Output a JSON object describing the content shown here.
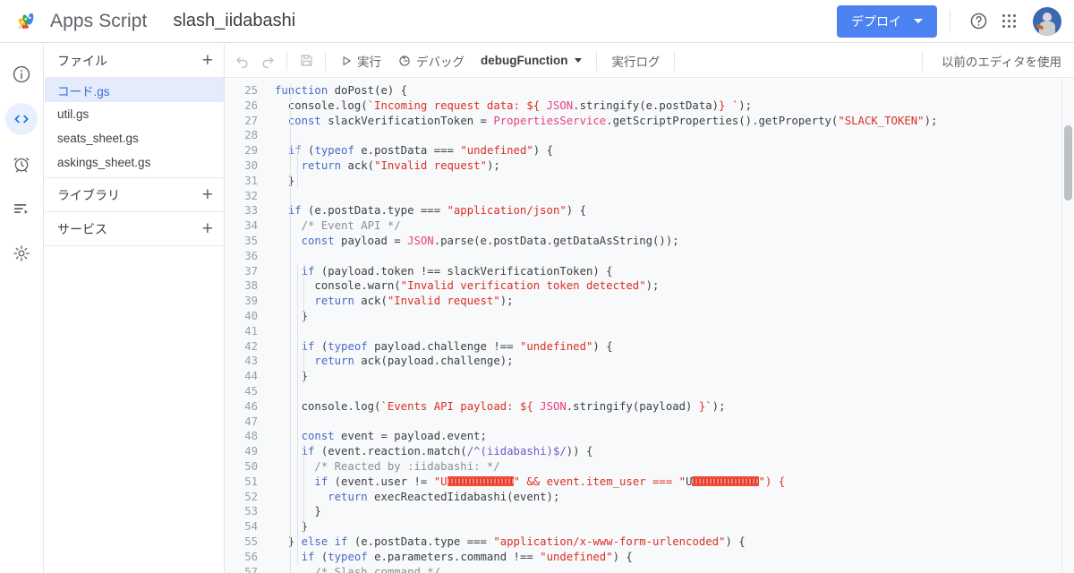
{
  "topbar": {
    "logo_icon": "apps-script-logo",
    "brand": "Apps Script",
    "project_title": "slash_iidabashi",
    "deploy_button": "デプロイ",
    "help_icon": "help-circle-icon",
    "apps_icon": "apps-grid-icon",
    "avatar_icon": "user-avatar"
  },
  "rail": {
    "items": [
      {
        "name": "overview",
        "icon": "info-circle-icon",
        "active": false
      },
      {
        "name": "editor",
        "icon": "code-brackets-icon",
        "active": true
      },
      {
        "name": "triggers",
        "icon": "alarm-clock-icon",
        "active": false
      },
      {
        "name": "executions",
        "icon": "executions-list-icon",
        "active": false
      },
      {
        "name": "settings",
        "icon": "gear-icon",
        "active": false
      }
    ]
  },
  "sidebar": {
    "files_header": "ファイル",
    "files_add_icon": "plus-icon",
    "files": [
      {
        "label": "コード.gs",
        "selected": true
      },
      {
        "label": "util.gs",
        "selected": false
      },
      {
        "label": "seats_sheet.gs",
        "selected": false
      },
      {
        "label": "askings_sheet.gs",
        "selected": false
      }
    ],
    "libraries_header": "ライブラリ",
    "libraries_add_icon": "plus-icon",
    "services_header": "サービス",
    "services_add_icon": "plus-icon"
  },
  "toolbar": {
    "undo_icon": "undo-arrow-icon",
    "redo_icon": "redo-arrow-icon",
    "save_icon": "save-disk-icon",
    "run_icon": "play-triangle-icon",
    "run_label": "実行",
    "debug_icon": "debug-bug-icon",
    "debug_label": "デバッグ",
    "function_selector": "debugFunction",
    "function_caret_icon": "caret-down-icon",
    "execution_log_label": "実行ログ",
    "legacy_editor_label": "以前のエディタを使用"
  },
  "editor": {
    "first_line_number": 25,
    "last_line_number": 57,
    "scrollbar_icon": "vertical-scrollbar-thumb",
    "lines": [
      {
        "n": 25,
        "t": "function doPost(e) {"
      },
      {
        "n": 26,
        "t": "  console.log(`Incoming request data: ${ JSON.stringify(e.postData)} `);"
      },
      {
        "n": 27,
        "t": "  const slackVerificationToken = PropertiesService.getScriptProperties().getProperty(\"SLACK_TOKEN\");"
      },
      {
        "n": 28,
        "t": ""
      },
      {
        "n": 29,
        "t": "  if (typeof e.postData === \"undefined\") {"
      },
      {
        "n": 30,
        "t": "    return ack(\"Invalid request\");"
      },
      {
        "n": 31,
        "t": "  }"
      },
      {
        "n": 32,
        "t": ""
      },
      {
        "n": 33,
        "t": "  if (e.postData.type === \"application/json\") {"
      },
      {
        "n": 34,
        "t": "    /* Event API */"
      },
      {
        "n": 35,
        "t": "    const payload = JSON.parse(e.postData.getDataAsString());"
      },
      {
        "n": 36,
        "t": ""
      },
      {
        "n": 37,
        "t": "    if (payload.token !== slackVerificationToken) {"
      },
      {
        "n": 38,
        "t": "      console.warn(\"Invalid verification token detected\");"
      },
      {
        "n": 39,
        "t": "      return ack(\"Invalid request\");"
      },
      {
        "n": 40,
        "t": "    }"
      },
      {
        "n": 41,
        "t": ""
      },
      {
        "n": 42,
        "t": "    if (typeof payload.challenge !== \"undefined\") {"
      },
      {
        "n": 43,
        "t": "      return ack(payload.challenge);"
      },
      {
        "n": 44,
        "t": "    }"
      },
      {
        "n": 45,
        "t": ""
      },
      {
        "n": 46,
        "t": "    console.log(`Events API payload: ${ JSON.stringify(payload) }`);"
      },
      {
        "n": 47,
        "t": ""
      },
      {
        "n": 48,
        "t": "    const event = payload.event;"
      },
      {
        "n": 49,
        "t": "    if (event.reaction.match(/^(iidabashi)$/)) {"
      },
      {
        "n": 50,
        "t": "      /* Reacted by :iidabashi: */"
      },
      {
        "n": 51,
        "t": "      if (event.user != \"U[redacted]\" && event.item_user === \"U[redacted]\") {"
      },
      {
        "n": 52,
        "t": "        return execReactedIidabashi(event);"
      },
      {
        "n": 53,
        "t": "      }"
      },
      {
        "n": 54,
        "t": "    }"
      },
      {
        "n": 55,
        "t": "  } else if (e.postData.type === \"application/x-www-form-urlencoded\") {"
      },
      {
        "n": 56,
        "t": "    if (typeof e.parameters.command !== \"undefined\") {"
      },
      {
        "n": 57,
        "t": "      /* Slash command */"
      }
    ]
  },
  "colors": {
    "accent_blue": "#4d82f3",
    "selected_file_bg": "#e4ebfb",
    "selected_file_text": "#3c6ddb",
    "editor_bg": "#f8f9fa",
    "keyword": "#4a69c9",
    "string": "#d93025",
    "class": "#e5427d",
    "comment": "#8a8f94",
    "redaction": "#f04b3a",
    "rail_active_bg": "#e8f0fe",
    "rail_active_fg": "#1a73e8"
  }
}
